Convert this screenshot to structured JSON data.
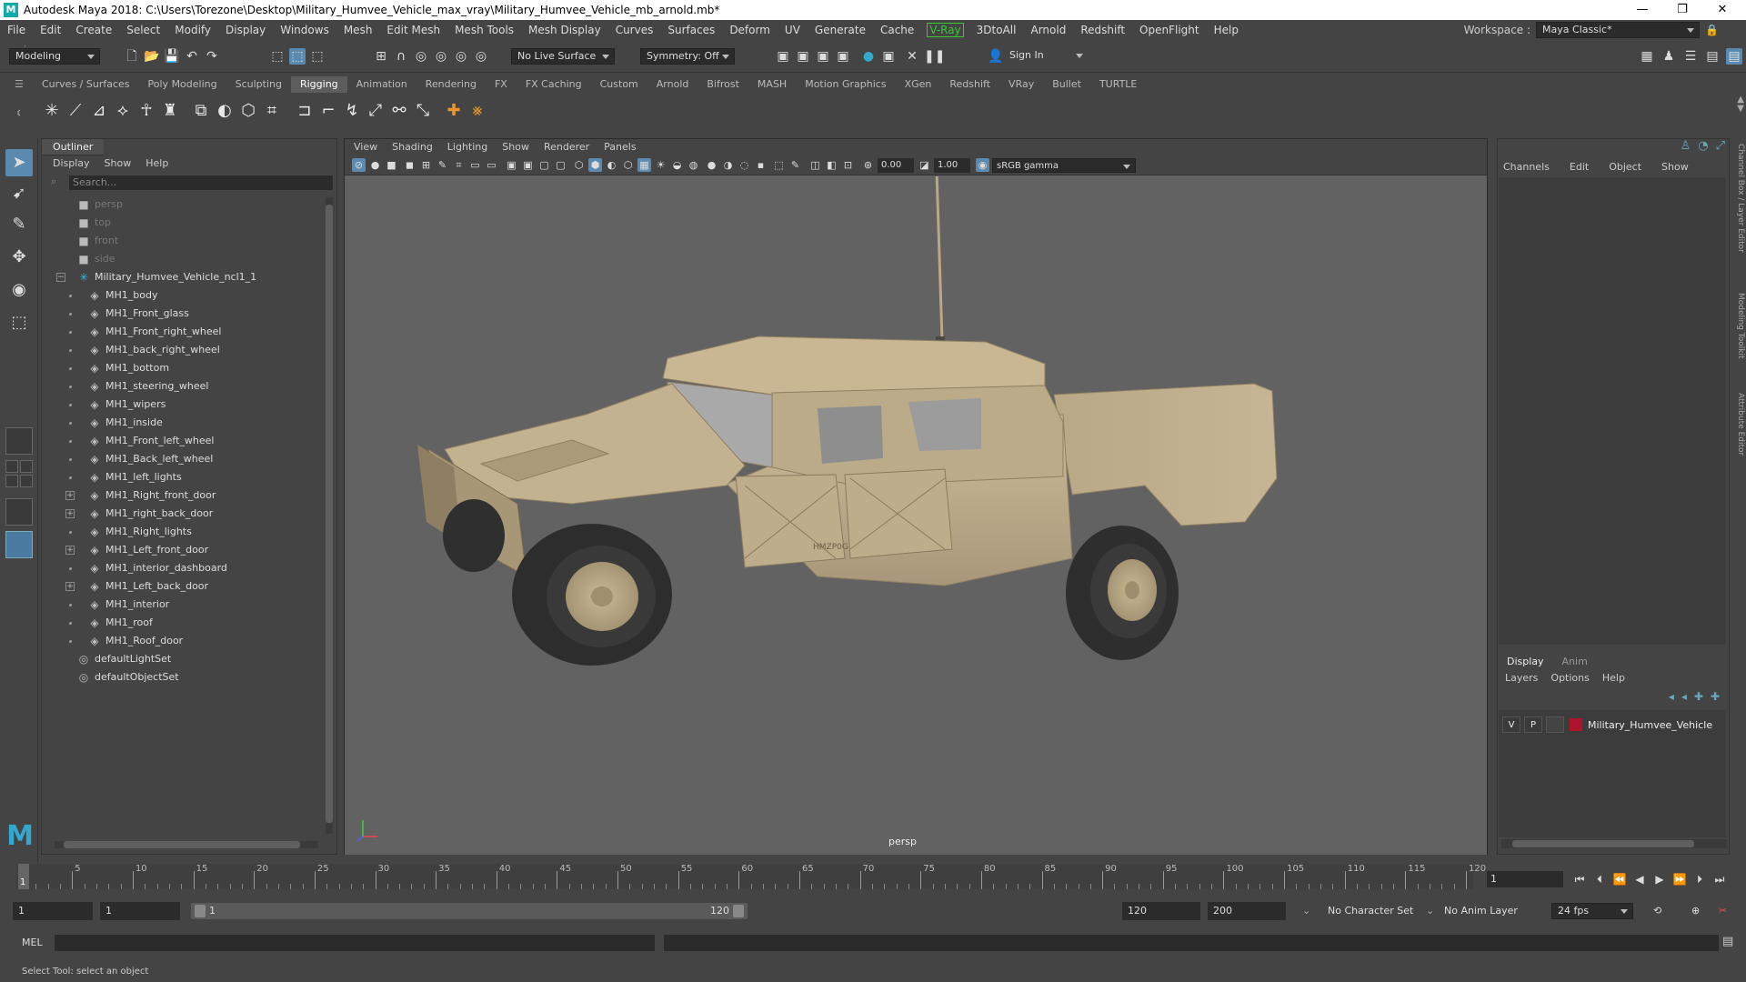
{
  "window": {
    "title": "Autodesk Maya 2018: C:\\Users\\Torezone\\Desktop\\Military_Humvee_Vehicle_max_vray\\Military_Humvee_Vehicle_mb_arnold.mb*",
    "controls": [
      "—",
      "❐",
      "✕"
    ]
  },
  "menubar": {
    "items": [
      "File",
      "Edit",
      "Create",
      "Select",
      "Modify",
      "Display",
      "Windows",
      "Mesh",
      "Edit Mesh",
      "Mesh Tools",
      "Mesh Display",
      "Curves",
      "Surfaces",
      "Deform",
      "UV",
      "Generate",
      "Cache",
      "V-Ray",
      "3DtoAll",
      "Arnold",
      "Redshift",
      "OpenFlight",
      "Help"
    ],
    "workspace_label": "Workspace :",
    "workspace_value": "Maya Classic*"
  },
  "statusline": {
    "mode": "Modeling",
    "live_surface": "No Live Surface",
    "symmetry": "Symmetry: Off",
    "sign_in": "Sign In"
  },
  "shelf": {
    "tabs": [
      "Curves / Surfaces",
      "Poly Modeling",
      "Sculpting",
      "Rigging",
      "Animation",
      "Rendering",
      "FX",
      "FX Caching",
      "Custom",
      "Arnold",
      "Bifrost",
      "MASH",
      "Motion Graphics",
      "XGen",
      "Redshift",
      "VRay",
      "Bullet",
      "TURTLE"
    ],
    "active_tab": "Rigging"
  },
  "outliner": {
    "title": "Outliner",
    "menu": [
      "Display",
      "Show",
      "Help"
    ],
    "search_placeholder": "Search...",
    "rows": [
      {
        "label": "persp",
        "icon": "camera-icon",
        "dim": true,
        "depth": 0,
        "expander": ""
      },
      {
        "label": "top",
        "icon": "camera-icon",
        "dim": true,
        "depth": 0,
        "expander": ""
      },
      {
        "label": "front",
        "icon": "camera-icon",
        "dim": true,
        "depth": 0,
        "expander": ""
      },
      {
        "label": "side",
        "icon": "camera-icon",
        "dim": true,
        "depth": 0,
        "expander": ""
      },
      {
        "label": "Military_Humvee_Vehicle_ncl1_1",
        "icon": "group-icon",
        "dim": false,
        "depth": 0,
        "expander": "−"
      },
      {
        "label": "MH1_body",
        "icon": "mesh-icon",
        "dim": false,
        "depth": 1,
        "expander": ""
      },
      {
        "label": "MH1_Front_glass",
        "icon": "mesh-icon",
        "dim": false,
        "depth": 1,
        "expander": ""
      },
      {
        "label": "MH1_Front_right_wheel",
        "icon": "mesh-icon",
        "dim": false,
        "depth": 1,
        "expander": ""
      },
      {
        "label": "MH1_back_right_wheel",
        "icon": "mesh-icon",
        "dim": false,
        "depth": 1,
        "expander": ""
      },
      {
        "label": "MH1_bottom",
        "icon": "mesh-icon",
        "dim": false,
        "depth": 1,
        "expander": ""
      },
      {
        "label": "MH1_steering_wheel",
        "icon": "mesh-icon",
        "dim": false,
        "depth": 1,
        "expander": ""
      },
      {
        "label": "MH1_wipers",
        "icon": "mesh-icon",
        "dim": false,
        "depth": 1,
        "expander": ""
      },
      {
        "label": "MH1_inside",
        "icon": "mesh-icon",
        "dim": false,
        "depth": 1,
        "expander": ""
      },
      {
        "label": "MH1_Front_left_wheel",
        "icon": "mesh-icon",
        "dim": false,
        "depth": 1,
        "expander": ""
      },
      {
        "label": "MH1_Back_left_wheel",
        "icon": "mesh-icon",
        "dim": false,
        "depth": 1,
        "expander": ""
      },
      {
        "label": "MH1_left_lights",
        "icon": "mesh-icon",
        "dim": false,
        "depth": 1,
        "expander": ""
      },
      {
        "label": "MH1_Right_front_door",
        "icon": "mesh-icon",
        "dim": false,
        "depth": 1,
        "expander": "+"
      },
      {
        "label": "MH1_right_back_door",
        "icon": "mesh-icon",
        "dim": false,
        "depth": 1,
        "expander": "+"
      },
      {
        "label": "MH1_Right_lights",
        "icon": "mesh-icon",
        "dim": false,
        "depth": 1,
        "expander": ""
      },
      {
        "label": "MH1_Left_front_door",
        "icon": "mesh-icon",
        "dim": false,
        "depth": 1,
        "expander": "+"
      },
      {
        "label": "MH1_interior_dashboard",
        "icon": "mesh-icon",
        "dim": false,
        "depth": 1,
        "expander": ""
      },
      {
        "label": "MH1_Left_back_door",
        "icon": "mesh-icon",
        "dim": false,
        "depth": 1,
        "expander": "+"
      },
      {
        "label": "MH1_interior",
        "icon": "mesh-icon",
        "dim": false,
        "depth": 1,
        "expander": ""
      },
      {
        "label": "MH1_roof",
        "icon": "mesh-icon",
        "dim": false,
        "depth": 1,
        "expander": ""
      },
      {
        "label": "MH1_Roof_door",
        "icon": "mesh-icon",
        "dim": false,
        "depth": 1,
        "expander": ""
      },
      {
        "label": "defaultLightSet",
        "icon": "set-icon",
        "dim": false,
        "depth": 0,
        "expander": ""
      },
      {
        "label": "defaultObjectSet",
        "icon": "set-icon",
        "dim": false,
        "depth": 0,
        "expander": ""
      }
    ]
  },
  "viewport": {
    "menu": [
      "View",
      "Shading",
      "Lighting",
      "Show",
      "Renderer",
      "Panels"
    ],
    "exposure": "0.00",
    "gamma": "1.00",
    "color_space": "sRGB gamma",
    "camera": "persp",
    "model_plate": "HMZP0G",
    "body_color": "#bba887"
  },
  "channelbox": {
    "menu": [
      "Channels",
      "Edit",
      "Object",
      "Show"
    ],
    "layer_tabs": [
      "Display",
      "Anim"
    ],
    "layer_menu": [
      "Layers",
      "Options",
      "Help"
    ],
    "layer": {
      "v": "V",
      "p": "P",
      "name": "Military_Humvee_Vehicle",
      "color": "#b0142c"
    },
    "side_tabs": [
      "Channel Box / Layer Editor",
      "Modeling Toolkit",
      "Attribute Editor"
    ]
  },
  "timeslider": {
    "labels": [
      "5",
      "10",
      "15",
      "20",
      "25",
      "30",
      "35",
      "40",
      "45",
      "50",
      "55",
      "60",
      "65",
      "70",
      "75",
      "80",
      "85",
      "90",
      "95",
      "100",
      "105",
      "110",
      "115",
      "120"
    ],
    "current_frame": "1",
    "frame_field": "1"
  },
  "range": {
    "start": "1",
    "playback_start": "1",
    "bar_start": "1",
    "bar_end": "120",
    "playback_end": "120",
    "end": "200",
    "character_set": "No Character Set",
    "anim_layer": "No Anim Layer",
    "fps": "24 fps"
  },
  "cmdline": {
    "label": "MEL"
  },
  "helpline": {
    "text": "Select Tool: select an object"
  }
}
